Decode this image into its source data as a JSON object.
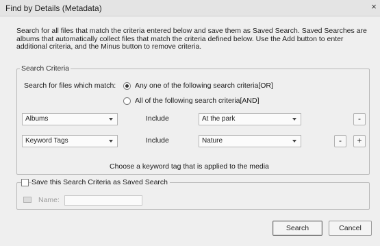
{
  "window": {
    "title": "Find by Details (Metadata)",
    "close_glyph": "×"
  },
  "description": "Search for all files that match the criteria entered below and save them as Saved Search. Saved Searches are albums that automatically collect files that match the criteria defined below. Use the Add button to enter additional criteria, and the Minus button to remove criteria.",
  "criteria": {
    "legend": "Search Criteria",
    "match_label": "Search for files which match:",
    "option_any": "Any one of the following search criteria[OR]",
    "option_all": "All of the following search criteria[AND]",
    "selected": "any",
    "rows": [
      {
        "field": "Albums",
        "operator": "Include",
        "value": "At the park",
        "buttons": [
          "-"
        ]
      },
      {
        "field": "Keyword Tags",
        "operator": "Include",
        "value": "Nature",
        "buttons": [
          "-",
          "+"
        ]
      }
    ]
  },
  "hint": "Choose a keyword tag that is applied to the media",
  "saved_search": {
    "checkbox_label": "Save this Search Criteria as Saved Search",
    "checked": false,
    "name_label": "Name:",
    "name_value": ""
  },
  "buttons": {
    "search": "Search",
    "cancel": "Cancel"
  }
}
